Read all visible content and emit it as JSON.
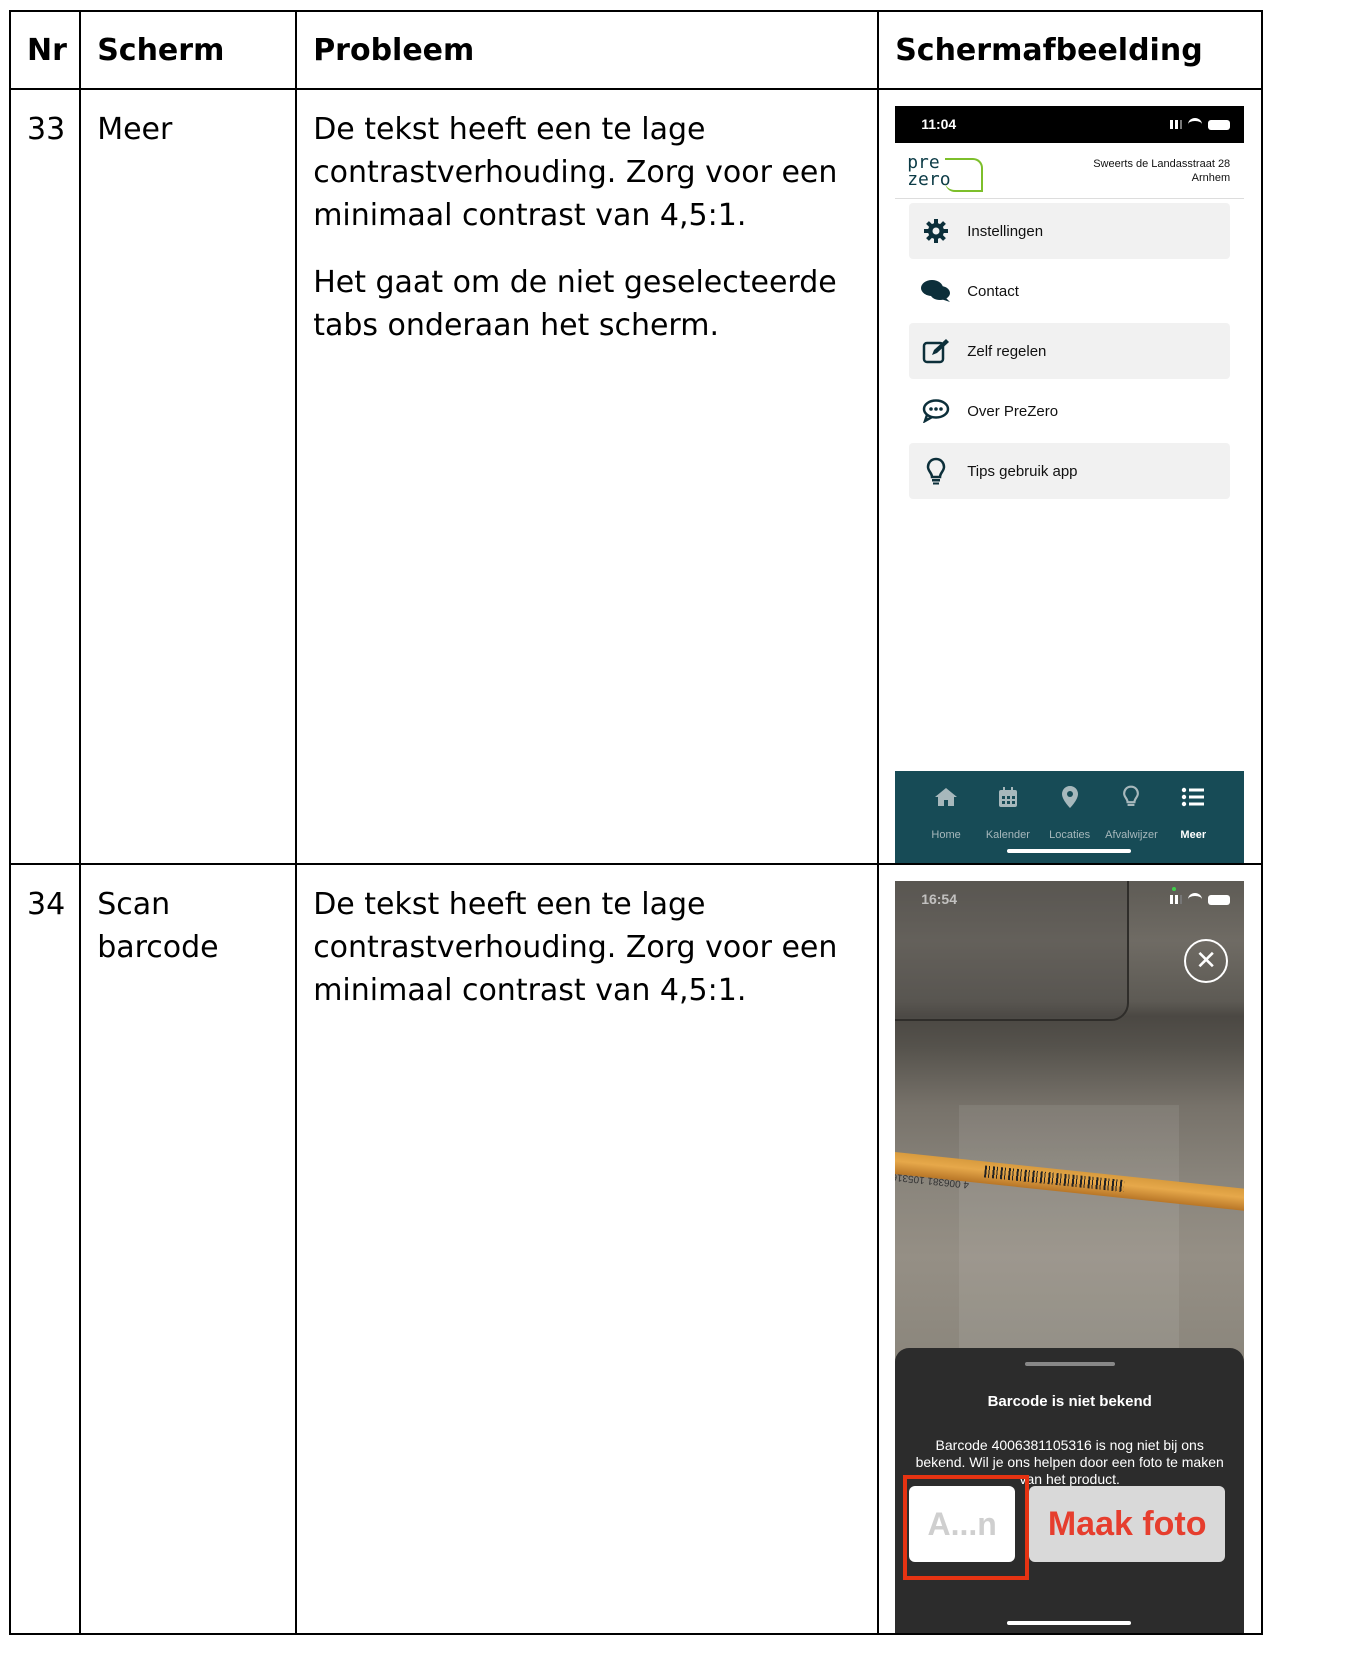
{
  "headers": {
    "nr": "Nr",
    "scherm": "Scherm",
    "probleem": "Probleem",
    "afbeelding": "Schermafbeelding"
  },
  "rows": [
    {
      "nr": "33",
      "scherm": "Meer",
      "probleem": [
        "De tekst heeft een te lage contrastverhouding. Zorg voor een minimaal contrast van 4,5:1.",
        "Het gaat om de niet geselecteerde tabs onderaan het scherm."
      ],
      "screenshot": {
        "time": "11:04",
        "logo_top": "pre",
        "logo_bottom": "zero",
        "address_line1": "Sweerts de Landasstraat 28",
        "address_line2": "Arnhem",
        "menu": [
          {
            "label": "Instellingen",
            "icon": "gear-icon"
          },
          {
            "label": "Contact",
            "icon": "chat-icon"
          },
          {
            "label": "Zelf regelen",
            "icon": "edit-icon"
          },
          {
            "label": "Over PreZero",
            "icon": "speech-bubble-icon"
          },
          {
            "label": "Tips gebruik app",
            "icon": "lightbulb-icon"
          }
        ],
        "tabs": [
          {
            "label": "Home",
            "icon": "home-icon"
          },
          {
            "label": "Kalender",
            "icon": "calendar-icon"
          },
          {
            "label": "Locaties",
            "icon": "location-pin-icon"
          },
          {
            "label": "Afvalwijzer",
            "icon": "lightbulb-icon"
          },
          {
            "label": "Meer",
            "icon": "list-icon",
            "selected": true
          }
        ],
        "tabbar_color": "#174b56"
      }
    },
    {
      "nr": "34",
      "scherm": "Scan barcode",
      "probleem": [
        "De tekst heeft een te lage contrastverhouding. Zorg voor een minimaal contrast van 4,5:1."
      ],
      "screenshot": {
        "time": "16:54",
        "pencil_text": "4 006381 105316",
        "sheet_title": "Barcode is niet bekend",
        "sheet_text": "Barcode 4006381105316 is nog niet bij ons bekend. Wil je ons helpen door een foto te maken van het product.",
        "button_left": "A...n",
        "button_right": "Maak foto",
        "highlight_color": "#e63312"
      }
    }
  ]
}
